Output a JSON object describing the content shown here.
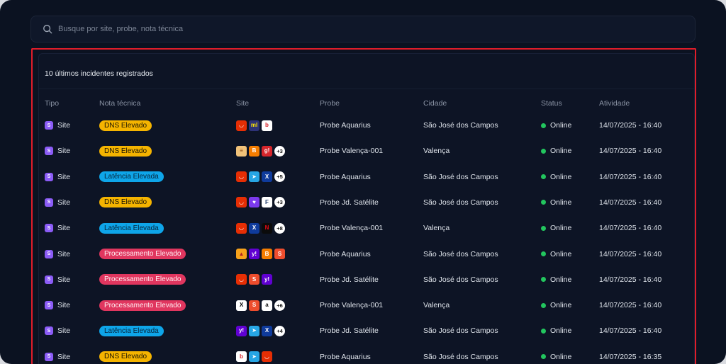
{
  "search": {
    "placeholder": "Busque por site, probe, nota técnica"
  },
  "panel": {
    "title": "10 últimos incidentes registrados"
  },
  "columns": {
    "tipo": "Tipo",
    "nota": "Nota técnica",
    "site": "Site",
    "probe": "Probe",
    "cidade": "Cidade",
    "status": "Status",
    "atividade": "Atividade"
  },
  "colors": {
    "dns": "#f5b400",
    "latencia": "#0ea5e9",
    "processamento": "#e0365f",
    "online": "#22c55e",
    "accent_border": "#e11d2a",
    "type_badge": "#8b5cf6"
  },
  "site_icon_styles": {
    "aliexpress-icon": {
      "bg": "#e62e04",
      "fg": "#ffffff",
      "glyph": "◡"
    },
    "mercadolivre-icon": {
      "bg": "#2d3277",
      "fg": "#ffe600",
      "glyph": "ml"
    },
    "bet-icon": {
      "bg": "#ffffff",
      "fg": "#d8232a",
      "glyph": "b"
    },
    "sandwich-icon": {
      "bg": "#f0c27a",
      "fg": "#8a4b13",
      "glyph": "≡"
    },
    "blogger-icon": {
      "bg": "#f57d00",
      "fg": "#ffffff",
      "glyph": "B"
    },
    "gt-icon": {
      "bg": "#d6262c",
      "fg": "#ffffff",
      "glyph": "g!"
    },
    "telegram-icon": {
      "bg": "#27a6e5",
      "fg": "#ffffff",
      "glyph": "➤"
    },
    "x-icon": {
      "bg": "#0f3b9c",
      "fg": "#ffffff",
      "glyph": "X"
    },
    "purple-heart-icon": {
      "bg": "#7c3aed",
      "fg": "#ffffff",
      "glyph": "♥"
    },
    "f-icon": {
      "bg": "#ffffff",
      "fg": "#1f3a6b",
      "glyph": "F"
    },
    "netflix-icon": {
      "bg": "#0b0b0b",
      "fg": "#e50914",
      "glyph": "N"
    },
    "pizza-icon": {
      "bg": "#f7a21b",
      "fg": "#b22222",
      "glyph": "▲"
    },
    "yahoo-icon": {
      "bg": "#6001d2",
      "fg": "#ffffff",
      "glyph": "y!"
    },
    "shopee-icon": {
      "bg": "#ee4d2d",
      "fg": "#ffffff",
      "glyph": "S"
    },
    "xp-icon": {
      "bg": "#ffffff",
      "fg": "#000000",
      "glyph": "X"
    },
    "amazon-icon": {
      "bg": "#ffffff",
      "fg": "#111111",
      "glyph": "a"
    }
  },
  "rows": [
    {
      "tipo": "Site",
      "nota": "DNS Elevado",
      "nota_kind": "dns",
      "icons": [
        "aliexpress-icon",
        "mercadolivre-icon",
        "bet-icon"
      ],
      "more": "",
      "probe": "Probe Aquarius",
      "cidade": "São José dos Campos",
      "status": "Online",
      "atividade": "14/07/2025 - 16:40"
    },
    {
      "tipo": "Site",
      "nota": "DNS Elevado",
      "nota_kind": "dns",
      "icons": [
        "sandwich-icon",
        "blogger-icon",
        "gt-icon"
      ],
      "more": "+3",
      "probe": "Probe Valença-001",
      "cidade": "Valença",
      "status": "Online",
      "atividade": "14/07/2025 - 16:40"
    },
    {
      "tipo": "Site",
      "nota": "Latência Elevada",
      "nota_kind": "lat",
      "icons": [
        "aliexpress-icon",
        "telegram-icon",
        "x-icon"
      ],
      "more": "+5",
      "probe": "Probe Aquarius",
      "cidade": "São José dos Campos",
      "status": "Online",
      "atividade": "14/07/2025 - 16:40"
    },
    {
      "tipo": "Site",
      "nota": "DNS Elevado",
      "nota_kind": "dns",
      "icons": [
        "aliexpress-icon",
        "purple-heart-icon",
        "f-icon"
      ],
      "more": "+3",
      "probe": "Probe Jd. Satélite",
      "cidade": "São José dos Campos",
      "status": "Online",
      "atividade": "14/07/2025 - 16:40"
    },
    {
      "tipo": "Site",
      "nota": "Latência Elevada",
      "nota_kind": "lat",
      "icons": [
        "aliexpress-icon",
        "x-icon",
        "netflix-icon"
      ],
      "more": "+8",
      "probe": "Probe Valença-001",
      "cidade": "Valença",
      "status": "Online",
      "atividade": "14/07/2025 - 16:40"
    },
    {
      "tipo": "Site",
      "nota": "Processamento Elevado",
      "nota_kind": "proc",
      "icons": [
        "pizza-icon",
        "yahoo-icon",
        "blogger-icon",
        "shopee-icon"
      ],
      "more": "",
      "probe": "Probe Aquarius",
      "cidade": "São José dos Campos",
      "status": "Online",
      "atividade": "14/07/2025 - 16:40"
    },
    {
      "tipo": "Site",
      "nota": "Processamento Elevado",
      "nota_kind": "proc",
      "icons": [
        "aliexpress-icon",
        "shopee-icon",
        "yahoo-icon"
      ],
      "more": "",
      "probe": "Probe Jd. Satélite",
      "cidade": "São José dos Campos",
      "status": "Online",
      "atividade": "14/07/2025 - 16:40"
    },
    {
      "tipo": "Site",
      "nota": "Processamento Elevado",
      "nota_kind": "proc",
      "icons": [
        "xp-icon",
        "shopee-icon",
        "amazon-icon"
      ],
      "more": "+6",
      "probe": "Probe Valença-001",
      "cidade": "Valença",
      "status": "Online",
      "atividade": "14/07/2025 - 16:40"
    },
    {
      "tipo": "Site",
      "nota": "Latência Elevada",
      "nota_kind": "lat",
      "icons": [
        "yahoo-icon",
        "telegram-icon",
        "x-icon"
      ],
      "more": "+4",
      "probe": "Probe Jd. Satélite",
      "cidade": "São José dos Campos",
      "status": "Online",
      "atividade": "14/07/2025 - 16:40"
    },
    {
      "tipo": "Site",
      "nota": "DNS Elevado",
      "nota_kind": "dns",
      "icons": [
        "bet-icon",
        "telegram-icon",
        "aliexpress-icon"
      ],
      "more": "",
      "probe": "Probe Aquarius",
      "cidade": "São José dos Campos",
      "status": "Online",
      "atividade": "14/07/2025 - 16:35"
    }
  ]
}
